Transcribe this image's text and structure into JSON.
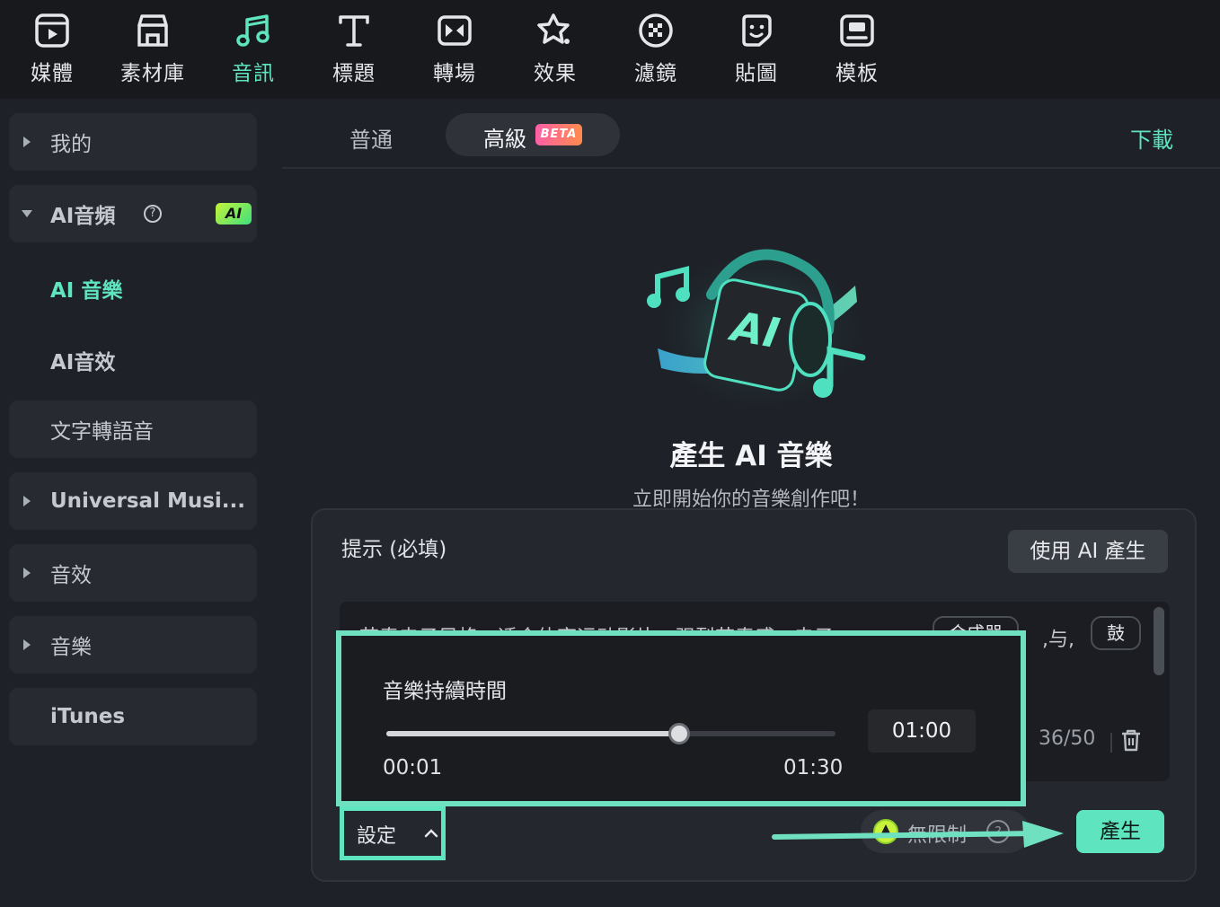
{
  "toolbar": {
    "items": [
      {
        "label": "媒體",
        "icon": "media-icon"
      },
      {
        "label": "素材庫",
        "icon": "stock-library-icon"
      },
      {
        "label": "音訊",
        "icon": "music-note-icon",
        "active": true
      },
      {
        "label": "標題",
        "icon": "title-text-icon"
      },
      {
        "label": "轉場",
        "icon": "transition-icon"
      },
      {
        "label": "效果",
        "icon": "effects-star-icon"
      },
      {
        "label": "濾鏡",
        "icon": "filter-icon"
      },
      {
        "label": "貼圖",
        "icon": "sticker-icon"
      },
      {
        "label": "模板",
        "icon": "template-icon"
      }
    ]
  },
  "sidebar": {
    "my": "我的",
    "ai_audio": "AI音頻",
    "ai_badge": "AI",
    "ai_music": "AI 音樂",
    "ai_sfx": "AI音效",
    "tts": "文字轉語音",
    "universal": "Universal Musi...",
    "sound_effects": "音效",
    "music": "音樂",
    "itunes": "iTunes"
  },
  "tabs": {
    "normal": "普通",
    "advanced": "高級",
    "beta": "BETA",
    "download": "下載"
  },
  "hero": {
    "title": "產生 AI 音樂",
    "subtitle": "立即開始你的音樂創作吧！"
  },
  "card": {
    "prompt_label": "提示 (必填)",
    "use_ai_button": "使用 AI 產生",
    "prompt_text": "节奏电子风格，适合体育运动影片，强烈节奏感，电子",
    "chip_synth": "合成器",
    "inline_and": ",与,",
    "chip_drum": "鼓",
    "char_count": "36/50",
    "settings_label": "設定",
    "unlimited_label": "無限制",
    "generate_button": "產生"
  },
  "duration": {
    "title": "音樂持續時間",
    "min_label": "00:01",
    "max_label": "01:30",
    "value_label": "01:00",
    "fraction": 0.652
  },
  "colors": {
    "accent": "#5ee5bf",
    "highlight": "#6fe0c0"
  }
}
